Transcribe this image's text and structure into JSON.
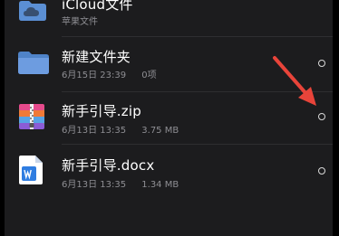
{
  "files": [
    {
      "name": "iCloud文件",
      "subtitle": "苹果文件",
      "icon": "icloud-folder-icon"
    },
    {
      "name": "新建文件夹",
      "date": "6月15日 23:39",
      "size": "0项",
      "icon": "folder-icon"
    },
    {
      "name": "新手引导.zip",
      "date": "6月13日 13:35",
      "size": "3.75 MB",
      "icon": "zip-archive-icon"
    },
    {
      "name": "新手引导.docx",
      "date": "6月13日 13:35",
      "size": "1.34 MB",
      "icon": "word-document-icon"
    }
  ],
  "colors": {
    "background": "#1c1c1e",
    "folder": "#5b8fd4",
    "annotation_arrow": "#e8443a",
    "word_blue": "#2f7de1"
  }
}
